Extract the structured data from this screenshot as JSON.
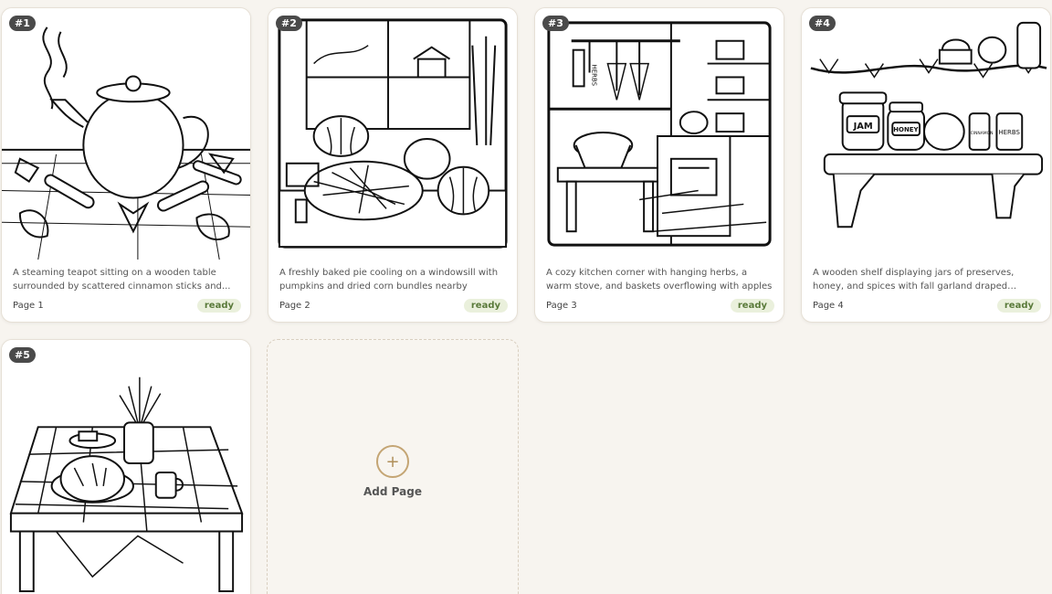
{
  "pages": [
    {
      "badge": "#1",
      "description": "A steaming teapot sitting on a wooden table surrounded by scattered cinnamon sticks and...",
      "page_label": "Page 1",
      "status": "ready"
    },
    {
      "badge": "#2",
      "description": "A freshly baked pie cooling on a windowsill with pumpkins and dried corn bundles nearby",
      "page_label": "Page 2",
      "status": "ready"
    },
    {
      "badge": "#3",
      "description": "A cozy kitchen corner with hanging herbs, a warm stove, and baskets overflowing with apples",
      "page_label": "Page 3",
      "status": "ready"
    },
    {
      "badge": "#4",
      "description": "A wooden shelf displaying jars of preserves, honey, and spices with fall garland draped acros...",
      "page_label": "Page 4",
      "status": "ready"
    },
    {
      "badge": "#5"
    }
  ],
  "illustration_text": {
    "herbs_tag": "HERBS",
    "jar_jam": "JAM",
    "jar_honey": "HONEY",
    "jar_cinnamon": "CINNAMON",
    "jar_herbs": "HERBS"
  },
  "add_page": {
    "icon": "plus-icon",
    "label": "Add Page"
  },
  "colors": {
    "background": "#f7f4ef",
    "status_bg": "#eaf0dc",
    "status_text": "#5a7a3a",
    "accent": "#c4a574"
  }
}
